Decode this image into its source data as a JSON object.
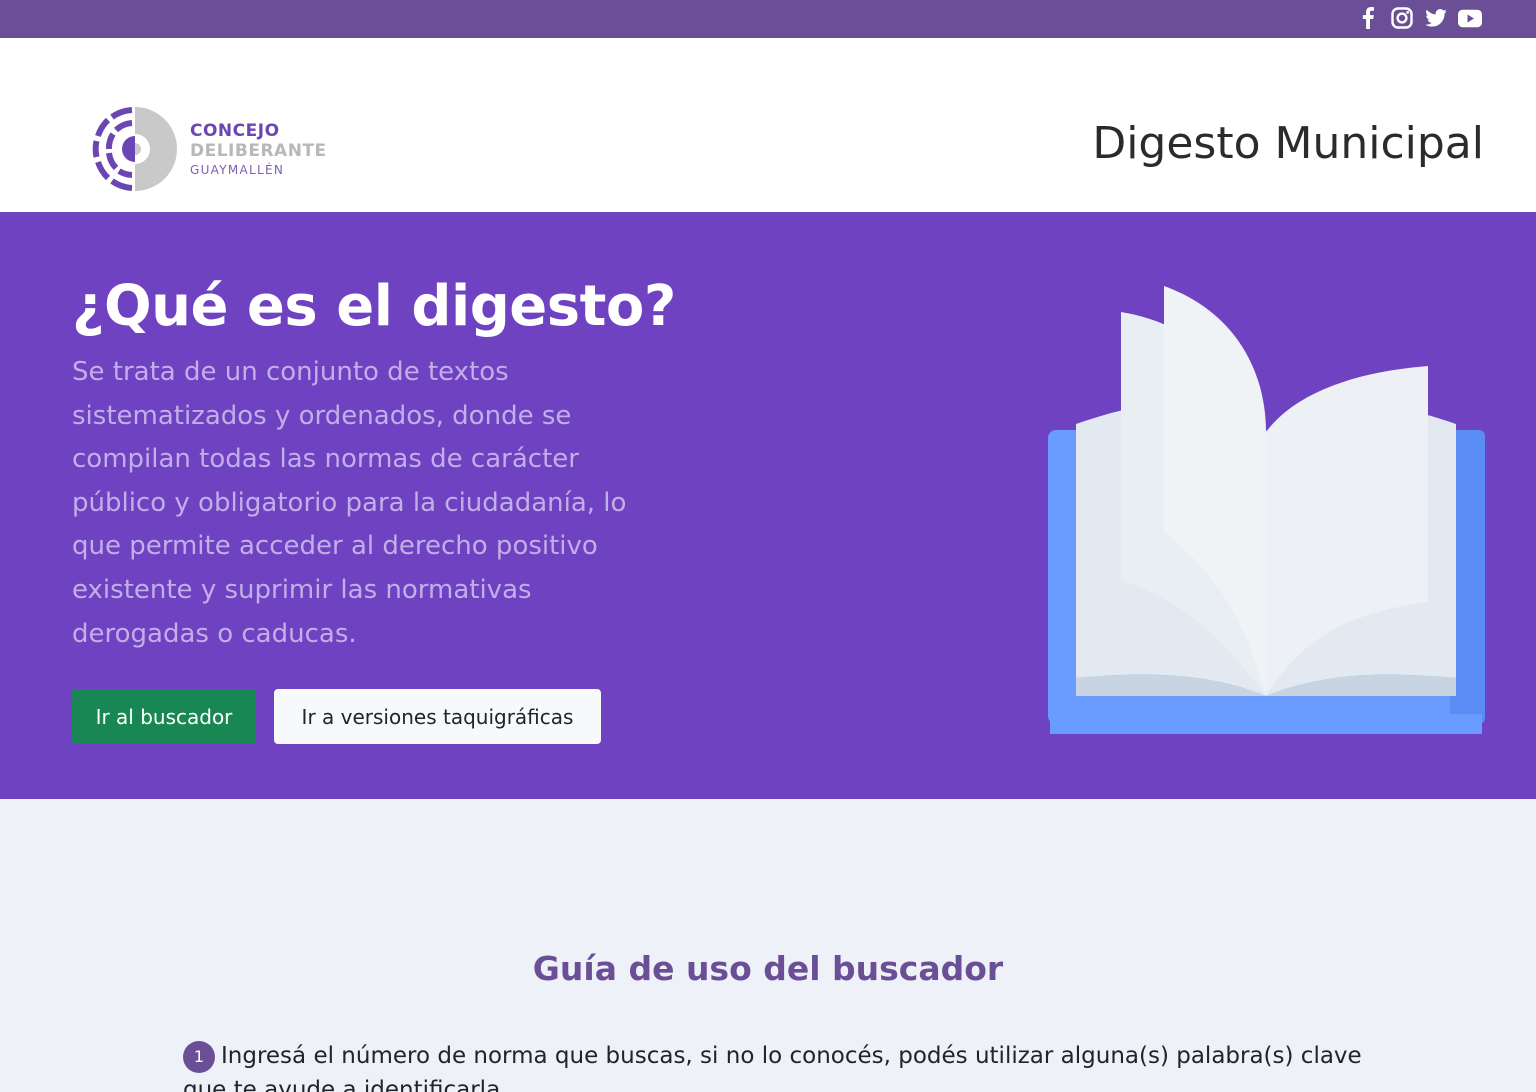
{
  "social": {
    "icons": [
      "facebook-icon",
      "instagram-icon",
      "twitter-icon",
      "youtube-icon"
    ]
  },
  "header": {
    "logo": {
      "line1": "CONCEJO",
      "line2": "DELIBERANTE",
      "line3": "GUAYMALLÉN"
    },
    "title": "Digesto Municipal"
  },
  "hero": {
    "title": "¿Qué es el digesto?",
    "description": "Se trata de un conjunto de textos sistematizados y ordenados, donde se compilan todas las normas de carácter público y obligatorio para la ciudadanía, lo que permite acceder al derecho positivo existente y suprimir las normativas derogadas o caducas.",
    "primary_button": "Ir al buscador",
    "secondary_button": "Ir a versiones taquigráficas",
    "illustration": "open-book-illustration"
  },
  "guide": {
    "title": "Guía de uso del buscador",
    "steps": [
      {
        "number": "1",
        "text": "Ingresá el número de norma que buscas, si no lo conocés, podés utilizar alguna(s) palabra(s) clave que te ayude a identificarla."
      }
    ]
  },
  "colors": {
    "topbar": "#6a4f96",
    "hero_bg": "#6f42c1",
    "hero_text": "#c2aee8",
    "primary_button": "#198754",
    "guide_title": "#6a4f96",
    "page_bg": "#eef1f8"
  }
}
